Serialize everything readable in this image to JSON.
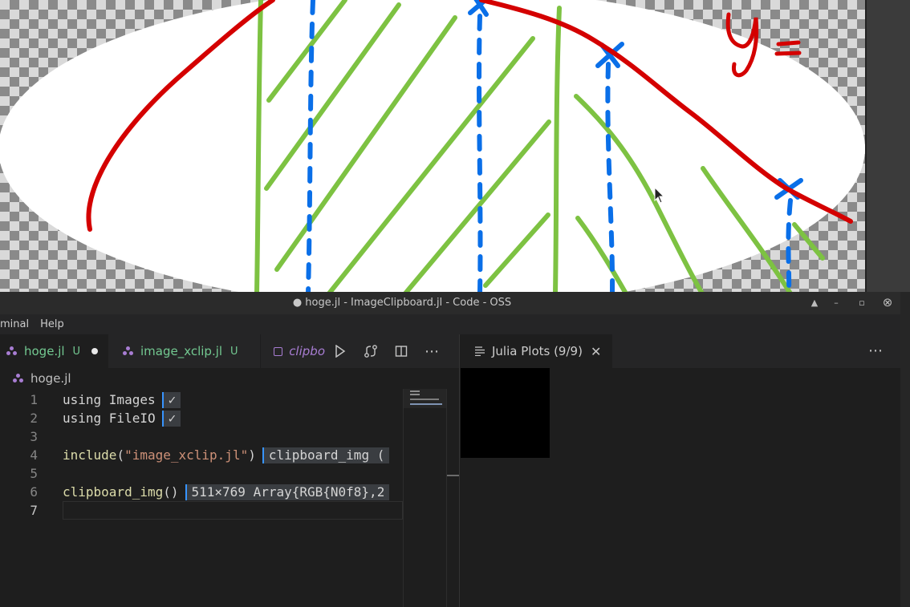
{
  "window": {
    "title": "● hoge.jl - ImageClipboard.jl - Code - OSS",
    "controls": [
      "▲",
      "–",
      "▫",
      "⊗"
    ]
  },
  "menu": {
    "items": [
      "minal",
      "Help"
    ]
  },
  "editor": {
    "tabs": [
      {
        "name": "hoge.jl",
        "badge": "U",
        "dirty": true
      },
      {
        "name": "image_xclip.jl",
        "badge": "U"
      },
      {
        "name": "clipbo"
      }
    ],
    "breadcrumb": "hoge.jl",
    "lines": [
      {
        "n": "1",
        "code": "using Images",
        "inline": "✓"
      },
      {
        "n": "2",
        "code": "using FileIO",
        "inline": "✓"
      },
      {
        "n": "3",
        "code": ""
      },
      {
        "n": "4",
        "code_fn": "include",
        "code_open": "(",
        "code_str": "\"image_xclip.jl\"",
        "code_close": ")",
        "inline": "clipboard_img ("
      },
      {
        "n": "5",
        "code": ""
      },
      {
        "n": "6",
        "code_fn": "clipboard_img",
        "code_rest": "()",
        "inline": "511×769 Array{RGB{N0f8},2"
      },
      {
        "n": "7",
        "code": ""
      }
    ]
  },
  "plots": {
    "tab_label": "Julia Plots (9/9)"
  },
  "colors": {
    "red_curve": "#d40000",
    "green_hatch": "#7dc242",
    "blue_dash": "#0a6fe8",
    "tab_untracked": "#73c991",
    "julia_icon": "#a87dd3"
  }
}
